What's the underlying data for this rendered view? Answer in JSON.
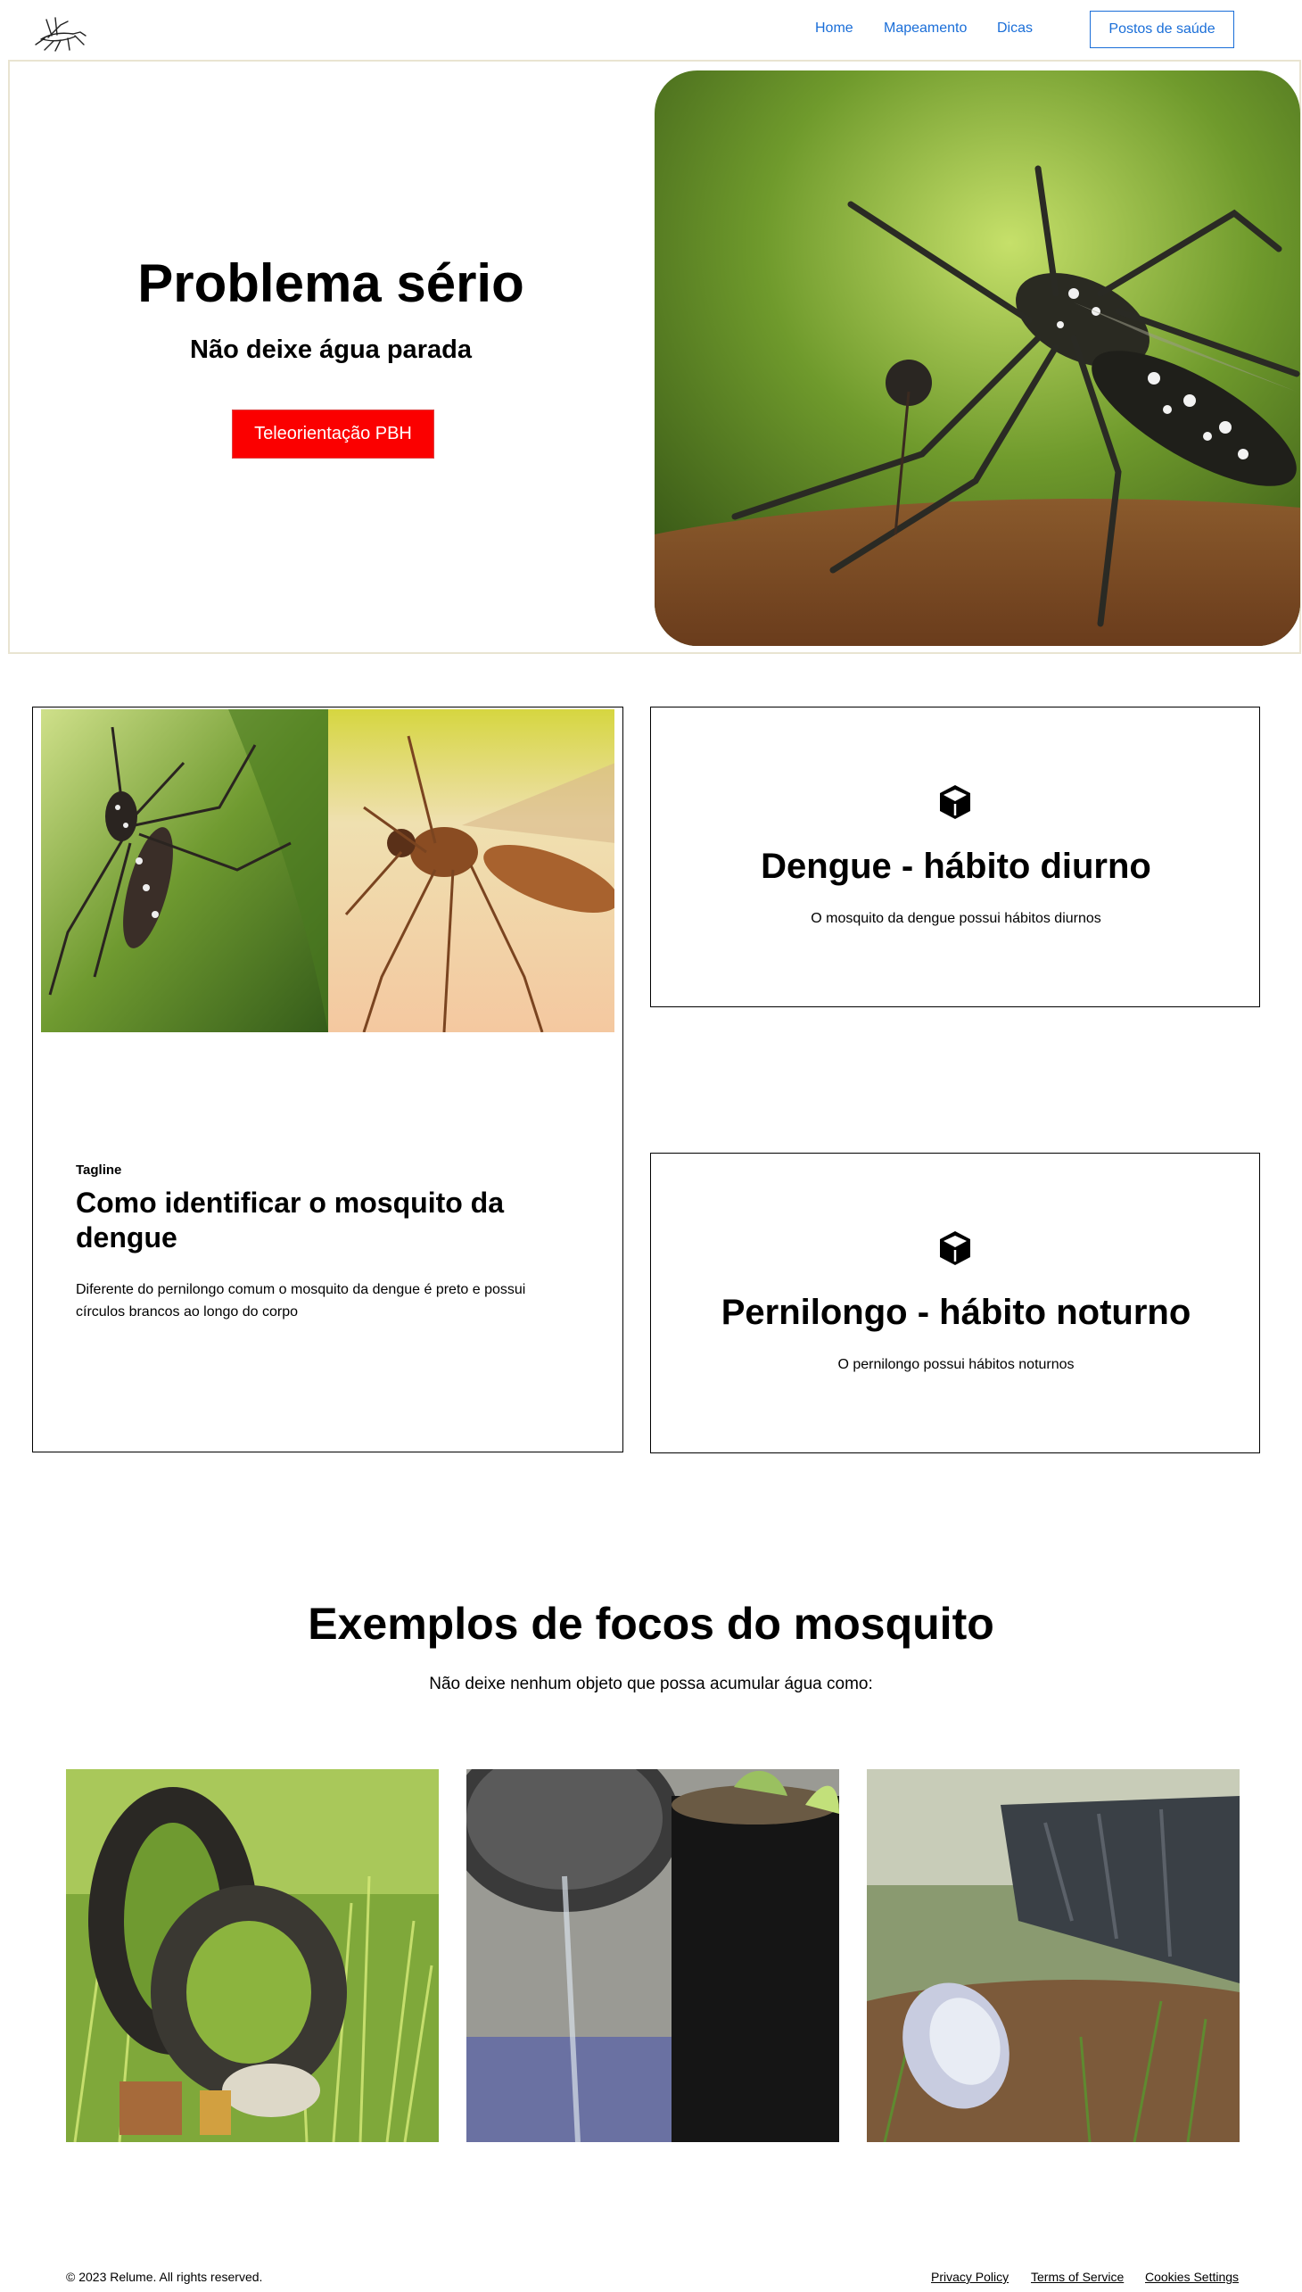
{
  "header": {
    "logo_icon": "mosquito-logo-icon",
    "nav": [
      "Home",
      "Mapeamento",
      "Dicas"
    ],
    "cta_label": "Postos de saúde",
    "link_color": "#1a6ed8"
  },
  "hero": {
    "title": "Problema sério",
    "subtitle": "Não deixe água parada",
    "button_label": "Teleorientação PBH",
    "button_color": "#fb0000",
    "image_icon": "mosquito-photo"
  },
  "identify": {
    "tagline": "Tagline",
    "title": "Como identificar o mosquito da dengue",
    "text": "Diferente do pernilongo comum o mosquito da dengue é preto e possui círculos brancos ao longo do corpo",
    "images": [
      "aedes-aegypti-photo",
      "pernilongo-photo"
    ]
  },
  "features": [
    {
      "icon": "cube-icon",
      "title": "Dengue - hábito diurno",
      "text": "O mosquito da dengue possui hábitos diurnos"
    },
    {
      "icon": "cube-icon",
      "title": "Pernilongo - hábito noturno",
      "text": "O pernilongo possui hábitos noturnos"
    }
  ],
  "examples": {
    "title": "Exemplos de focos do mosquito",
    "subtitle": "Não deixe nenhum objeto que possa acumular água como:",
    "images": [
      "tires-photo",
      "plant-pot-photo",
      "plastic-bowl-photo"
    ]
  },
  "footer": {
    "copyright": "© 2023 Relume. All rights reserved.",
    "links": [
      "Privacy Policy",
      "Terms of Service",
      "Cookies Settings"
    ]
  }
}
